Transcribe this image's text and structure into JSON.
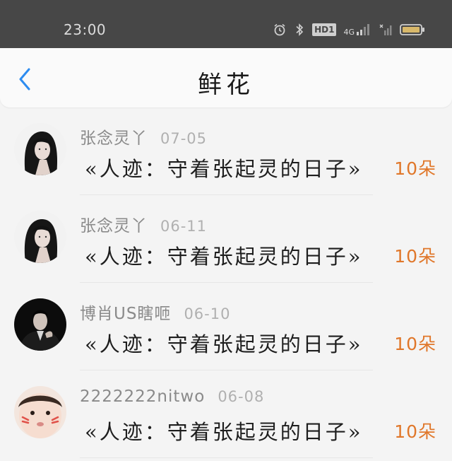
{
  "status_bar": {
    "time": "23:00",
    "hd_label": "HD1",
    "network_label": "4G",
    "icons": [
      "alarm-icon",
      "bluetooth-icon",
      "hd-icon",
      "signal-icon",
      "battery-icon"
    ]
  },
  "nav": {
    "title": "鲜花",
    "back_icon": "chevron-left-icon",
    "accent_color": "#2d8cf0"
  },
  "list": {
    "count_color": "#e0772a",
    "items": [
      {
        "username": "张念灵丫",
        "date": "07-05",
        "title": "«人迹：守着张起灵的日子»",
        "count": "10朵",
        "avatar": "avatar-girl-dark-hair"
      },
      {
        "username": "张念灵丫",
        "date": "06-11",
        "title": "«人迹：守着张起灵的日子»",
        "count": "10朵",
        "avatar": "avatar-girl-dark-hair"
      },
      {
        "username": "博肖US瞎咂",
        "date": "06-10",
        "title": "«人迹：守着张起灵的日子»",
        "count": "10朵",
        "avatar": "avatar-man-suit"
      },
      {
        "username": "2222222nitwo",
        "date": "06-08",
        "title": "«人迹：守着张起灵的日子»",
        "count": "10朵",
        "avatar": "avatar-baby-face"
      }
    ]
  }
}
